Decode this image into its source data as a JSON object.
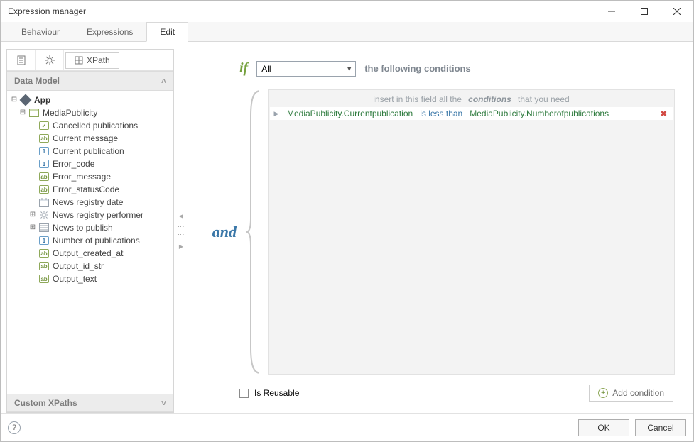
{
  "window": {
    "title": "Expression manager"
  },
  "tabs": {
    "items": [
      "Behaviour",
      "Expressions",
      "Edit"
    ],
    "active": 2
  },
  "leftToolbar": {
    "xpath_tab": "XPath"
  },
  "dataModel": {
    "header": "Data Model",
    "root": "App",
    "entity": "MediaPublicity",
    "attrs": [
      {
        "label": "Cancelled publications",
        "t": "chk"
      },
      {
        "label": "Current message",
        "t": "ab"
      },
      {
        "label": "Current publication",
        "t": "1"
      },
      {
        "label": "Error_code",
        "t": "1"
      },
      {
        "label": "Error_message",
        "t": "ab"
      },
      {
        "label": "Error_statusCode",
        "t": "ab"
      },
      {
        "label": "News registry date",
        "t": "date"
      },
      {
        "label": "News registry performer",
        "t": "gear",
        "expandable": true
      },
      {
        "label": "News to publish",
        "t": "list",
        "expandable": true
      },
      {
        "label": "Number of publications",
        "t": "1"
      },
      {
        "label": "Output_created_at",
        "t": "ab"
      },
      {
        "label": "Output_id_str",
        "t": "ab"
      },
      {
        "label": "Output_text",
        "t": "ab"
      }
    ]
  },
  "customXPaths": {
    "header": "Custom XPaths"
  },
  "expr": {
    "if_kw": "if",
    "combo_value": "All",
    "following": "the following conditions",
    "placeholder_pre": "insert in this field all the",
    "placeholder_em": "conditions",
    "placeholder_post": "that you need",
    "and_kw": "and",
    "condition": {
      "left": "MediaPublicity.Currentpublication",
      "op": "is less than",
      "right": "MediaPublicity.Numberofpublications"
    },
    "reusable_label": "Is Reusable",
    "add_condition": "Add condition"
  },
  "buttons": {
    "ok": "OK",
    "cancel": "Cancel"
  }
}
